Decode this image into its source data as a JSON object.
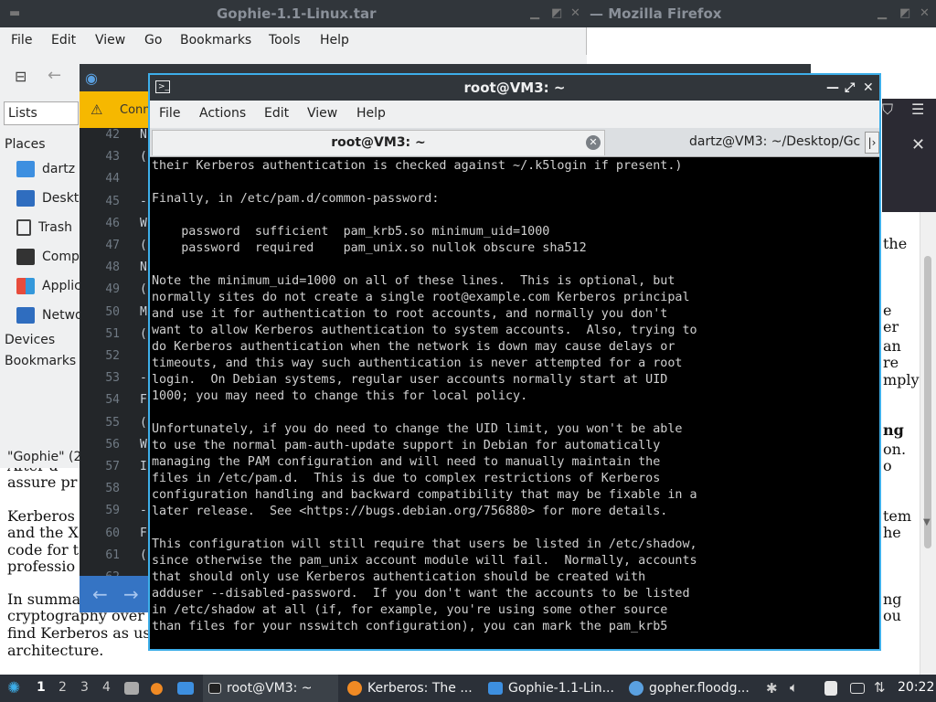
{
  "firefox": {
    "title": "Gophie-1.1-Linux.tar",
    "title_suffix": "— Mozilla Firefox",
    "page_lines": {
      "a": "the",
      "b": "e",
      "c": "er",
      "d": "an",
      "e": "re",
      "f": "mply",
      "g": "ng",
      "h": "on.",
      "i": "o",
      "j": "tem",
      "k": "he",
      "l": "ng",
      "m": "ou",
      "n1": "After a",
      "n2": "assure pr",
      "n3": "Kerberos",
      "n4": "and the X",
      "n5": "code for t",
      "n6": "professio",
      "n7": "In summa",
      "n8": "cryptography over",
      "n9": "find Kerberos as us",
      "n10": "architecture."
    }
  },
  "filemanager": {
    "menu": [
      "File",
      "Edit",
      "View",
      "Go",
      "Bookmarks",
      "Tools",
      "Help"
    ],
    "lists_label": "Lists",
    "places_label": "Places",
    "places": [
      "dartz",
      "Deskt",
      "Trash",
      "Comp",
      "Applic",
      "Netwo"
    ],
    "devices_label": "Devices",
    "bookmarks_label": "Bookmarks",
    "status": "\"Gophie\" (2"
  },
  "editor": {
    "warning": "Conn",
    "line_numbers": [
      "42",
      "43",
      "44",
      "45",
      "46",
      "47",
      "48",
      "49",
      "50",
      "51",
      "52",
      "53",
      "54",
      "55",
      "56",
      "57",
      "58",
      "59",
      "60",
      "61",
      "62"
    ],
    "visible_chars": [
      "N",
      "(",
      "",
      "-",
      "W",
      "(",
      "N",
      "(",
      "M",
      "(",
      "",
      "-",
      "F",
      "(",
      "W",
      "I",
      "",
      "-",
      "F",
      "(",
      ""
    ]
  },
  "terminal": {
    "title": "root@VM3: ~",
    "menu": [
      "File",
      "Actions",
      "Edit",
      "View",
      "Help"
    ],
    "tab_active": "root@VM3: ~",
    "tab_other": "dartz@VM3: ~/Desktop/Gc",
    "lines": [
      "their Kerberos authentication is checked against ~/.k5login if present.)",
      "",
      "Finally, in /etc/pam.d/common-password:",
      "",
      "    password  sufficient  pam_krb5.so minimum_uid=1000",
      "    password  required    pam_unix.so nullok obscure sha512",
      "",
      "Note the minimum_uid=1000 on all of these lines.  This is optional, but",
      "normally sites do not create a single root@example.com Kerberos principal",
      "and use it for authentication to root accounts, and normally you don't",
      "want to allow Kerberos authentication to system accounts.  Also, trying to",
      "do Kerberos authentication when the network is down may cause delays or",
      "timeouts, and this way such authentication is never attempted for a root",
      "login.  On Debian systems, regular user accounts normally start at UID",
      "1000; you may need to change this for local policy.",
      "",
      "Unfortunately, if you do need to change the UID limit, you won't be able",
      "to use the normal pam-auth-update support in Debian for automatically",
      "managing the PAM configuration and will need to manually maintain the",
      "files in /etc/pam.d.  This is due to complex restrictions of Kerberos",
      "configuration handling and backward compatibility that may be fixable in a",
      "later release.  See <https://bugs.debian.org/756880> for more details.",
      "",
      "This configuration will still require that users be listed in /etc/shadow,",
      "since otherwise the pam_unix account module will fail.  Normally, accounts",
      "that should only use Kerberos authentication should be created with",
      "adduser --disabled-password.  If you don't want the accounts to be listed",
      "in /etc/shadow at all (if, for example, you're using some other source",
      "than files for your nsswitch configuration), you can mark the pam_krb5"
    ]
  },
  "taskbar": {
    "workspaces": [
      "1",
      "2",
      "3",
      "4"
    ],
    "tasks": [
      "root@VM3: ~",
      "Kerberos: The ...",
      "Gophie-1.1-Lin...",
      "gopher.floodg..."
    ],
    "clock": "20:22"
  },
  "colors": {
    "accent": "#3daee9",
    "panel": "#31363b",
    "warning": "#f6b800",
    "editor_nav": "#3574c4"
  }
}
